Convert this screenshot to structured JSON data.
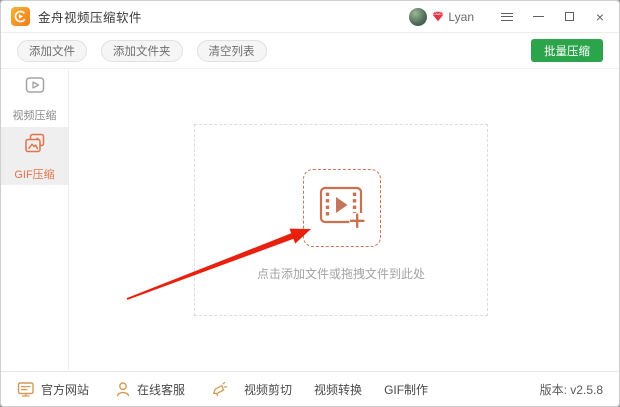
{
  "titlebar": {
    "app_title": "金舟视频压缩软件",
    "user_name": "Lyan"
  },
  "toolbar": {
    "add_file_label": "添加文件",
    "add_folder_label": "添加文件夹",
    "clear_list_label": "清空列表",
    "batch_compress_label": "批量压缩"
  },
  "sidebar": {
    "items": [
      {
        "label": "视频压缩",
        "active": false
      },
      {
        "label": "GIF压缩",
        "active": true
      }
    ]
  },
  "dropzone": {
    "hint": "点击添加文件或拖拽文件到此处"
  },
  "statusbar": {
    "official_site_label": "官方网站",
    "online_support_label": "在线客服",
    "video_cut_label": "视频剪切",
    "video_convert_label": "视频转换",
    "gif_maker_label": "GIF制作",
    "version": "版本: v2.5.8"
  },
  "colors": {
    "accent_orange": "#cd7458",
    "sidebar_active_orange": "#e4724a",
    "statusbar_icon_tan": "#d49a55",
    "batch_green": "#2ca44c",
    "arrow_red": "#e8210f",
    "sidebar_selected_bg": "#efefef"
  }
}
